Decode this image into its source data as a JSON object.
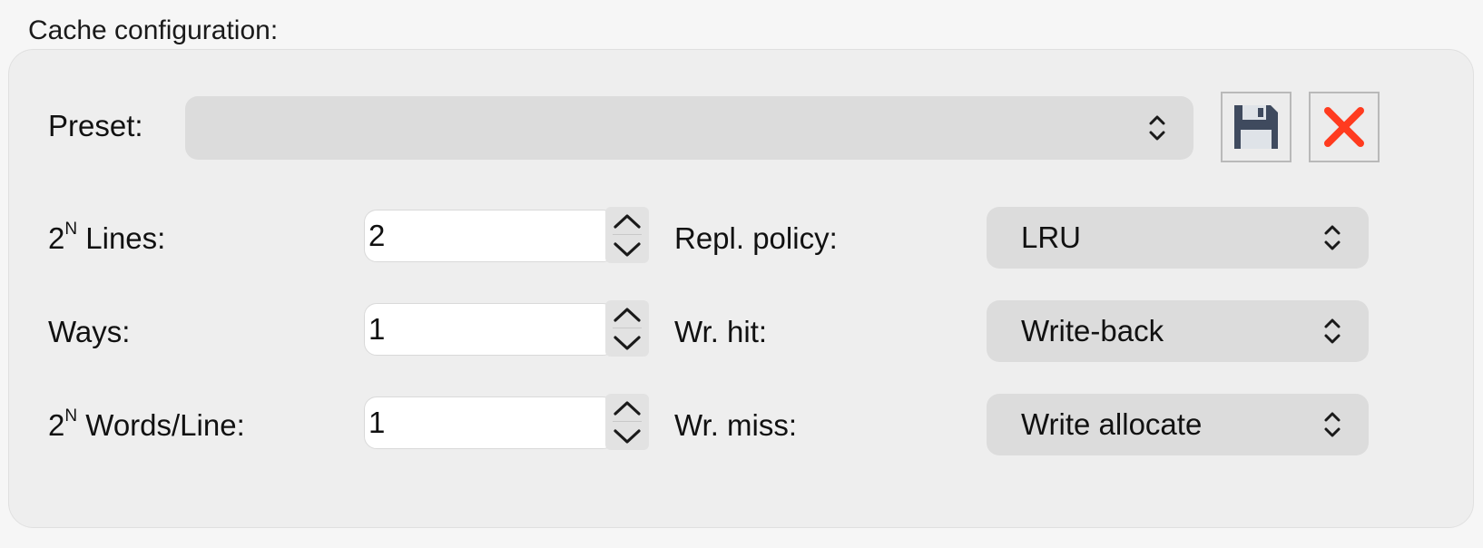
{
  "group": {
    "title": "Cache configuration:"
  },
  "preset": {
    "label": "Preset:",
    "value": "",
    "icons": {
      "combo": "updown-chevron-icon",
      "save": "floppy-disk-icon",
      "remove": "red-x-icon"
    }
  },
  "lines": {
    "label_base": "2",
    "label_sup": "N",
    "label_rest": " Lines:",
    "value": "2"
  },
  "ways": {
    "label": "Ways:",
    "value": "1"
  },
  "words": {
    "label_base": "2",
    "label_sup": "N",
    "label_rest": " Words/Line:",
    "value": "1"
  },
  "repl_policy": {
    "label": "Repl. policy:",
    "value": "LRU"
  },
  "wr_hit": {
    "label": "Wr. hit:",
    "value": "Write-back"
  },
  "wr_miss": {
    "label": "Wr. miss:",
    "value": "Write allocate"
  },
  "colors": {
    "save_icon": "#3f4a5e",
    "remove_icon": "#ff3b1f",
    "group_bg": "#eeeeee",
    "combo_bg": "#dcdcdc"
  }
}
